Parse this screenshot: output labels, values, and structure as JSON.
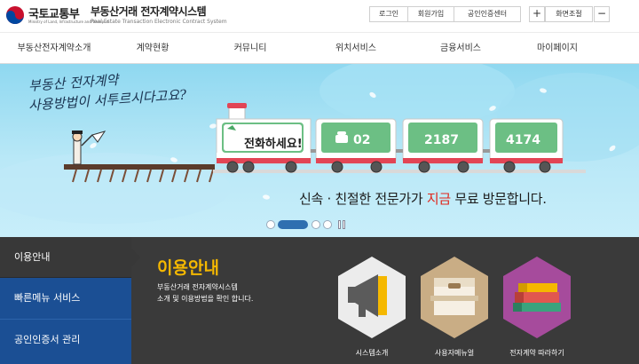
{
  "header": {
    "ministry": "국토교통부",
    "ministry_en": "Ministry of Land, Infrastructure and Transport",
    "system_title": "부동산거래 전자계약시스템",
    "system_subtitle": "Real Estate Transaction Electronic Contract System",
    "util": {
      "login": "로그인",
      "join": "회원가입",
      "cert_center": "공인인증센터",
      "zoom_in": "+",
      "zoom_label": "화면조절",
      "zoom_out": "−"
    }
  },
  "nav": {
    "items": [
      "부동산전자계약소개",
      "계약현황",
      "커뮤니티",
      "위치서비스",
      "금융서비스",
      "마이페이지"
    ]
  },
  "banner": {
    "question_line1": "부동산 전자계약",
    "question_line2": "사용방법이 서투르시다고요?",
    "train_call": "전화하세요!",
    "phone_1": "02",
    "phone_2": "2187",
    "phone_3": "4174",
    "tagline_pre": "신속 · 친절한 전문가가 ",
    "tagline_highlight": "지금",
    "tagline_post": " 무료 방문합니다.",
    "slides_total": 4,
    "slide_active": 1
  },
  "bottom": {
    "tabs": [
      "이용안내",
      "빠른메뉴 서비스",
      "공인인증서 관리"
    ],
    "active_tab": 0,
    "section_title": "이용안내",
    "section_desc_line1": "부동산거래 전자계약시스템",
    "section_desc_line2": "소개 및 이용방법을 확인 합니다.",
    "features": [
      {
        "label": "시스템소개",
        "icon": "megaphone-icon"
      },
      {
        "label": "사용자메뉴얼",
        "icon": "file-box-icon"
      },
      {
        "label": "전자계약 따라하기",
        "icon": "books-icon"
      }
    ]
  },
  "colors": {
    "brand_blue": "#1b4f94",
    "highlight_red": "#e0261b",
    "title_yellow": "#f5b800",
    "train_green": "#6cbf84"
  }
}
